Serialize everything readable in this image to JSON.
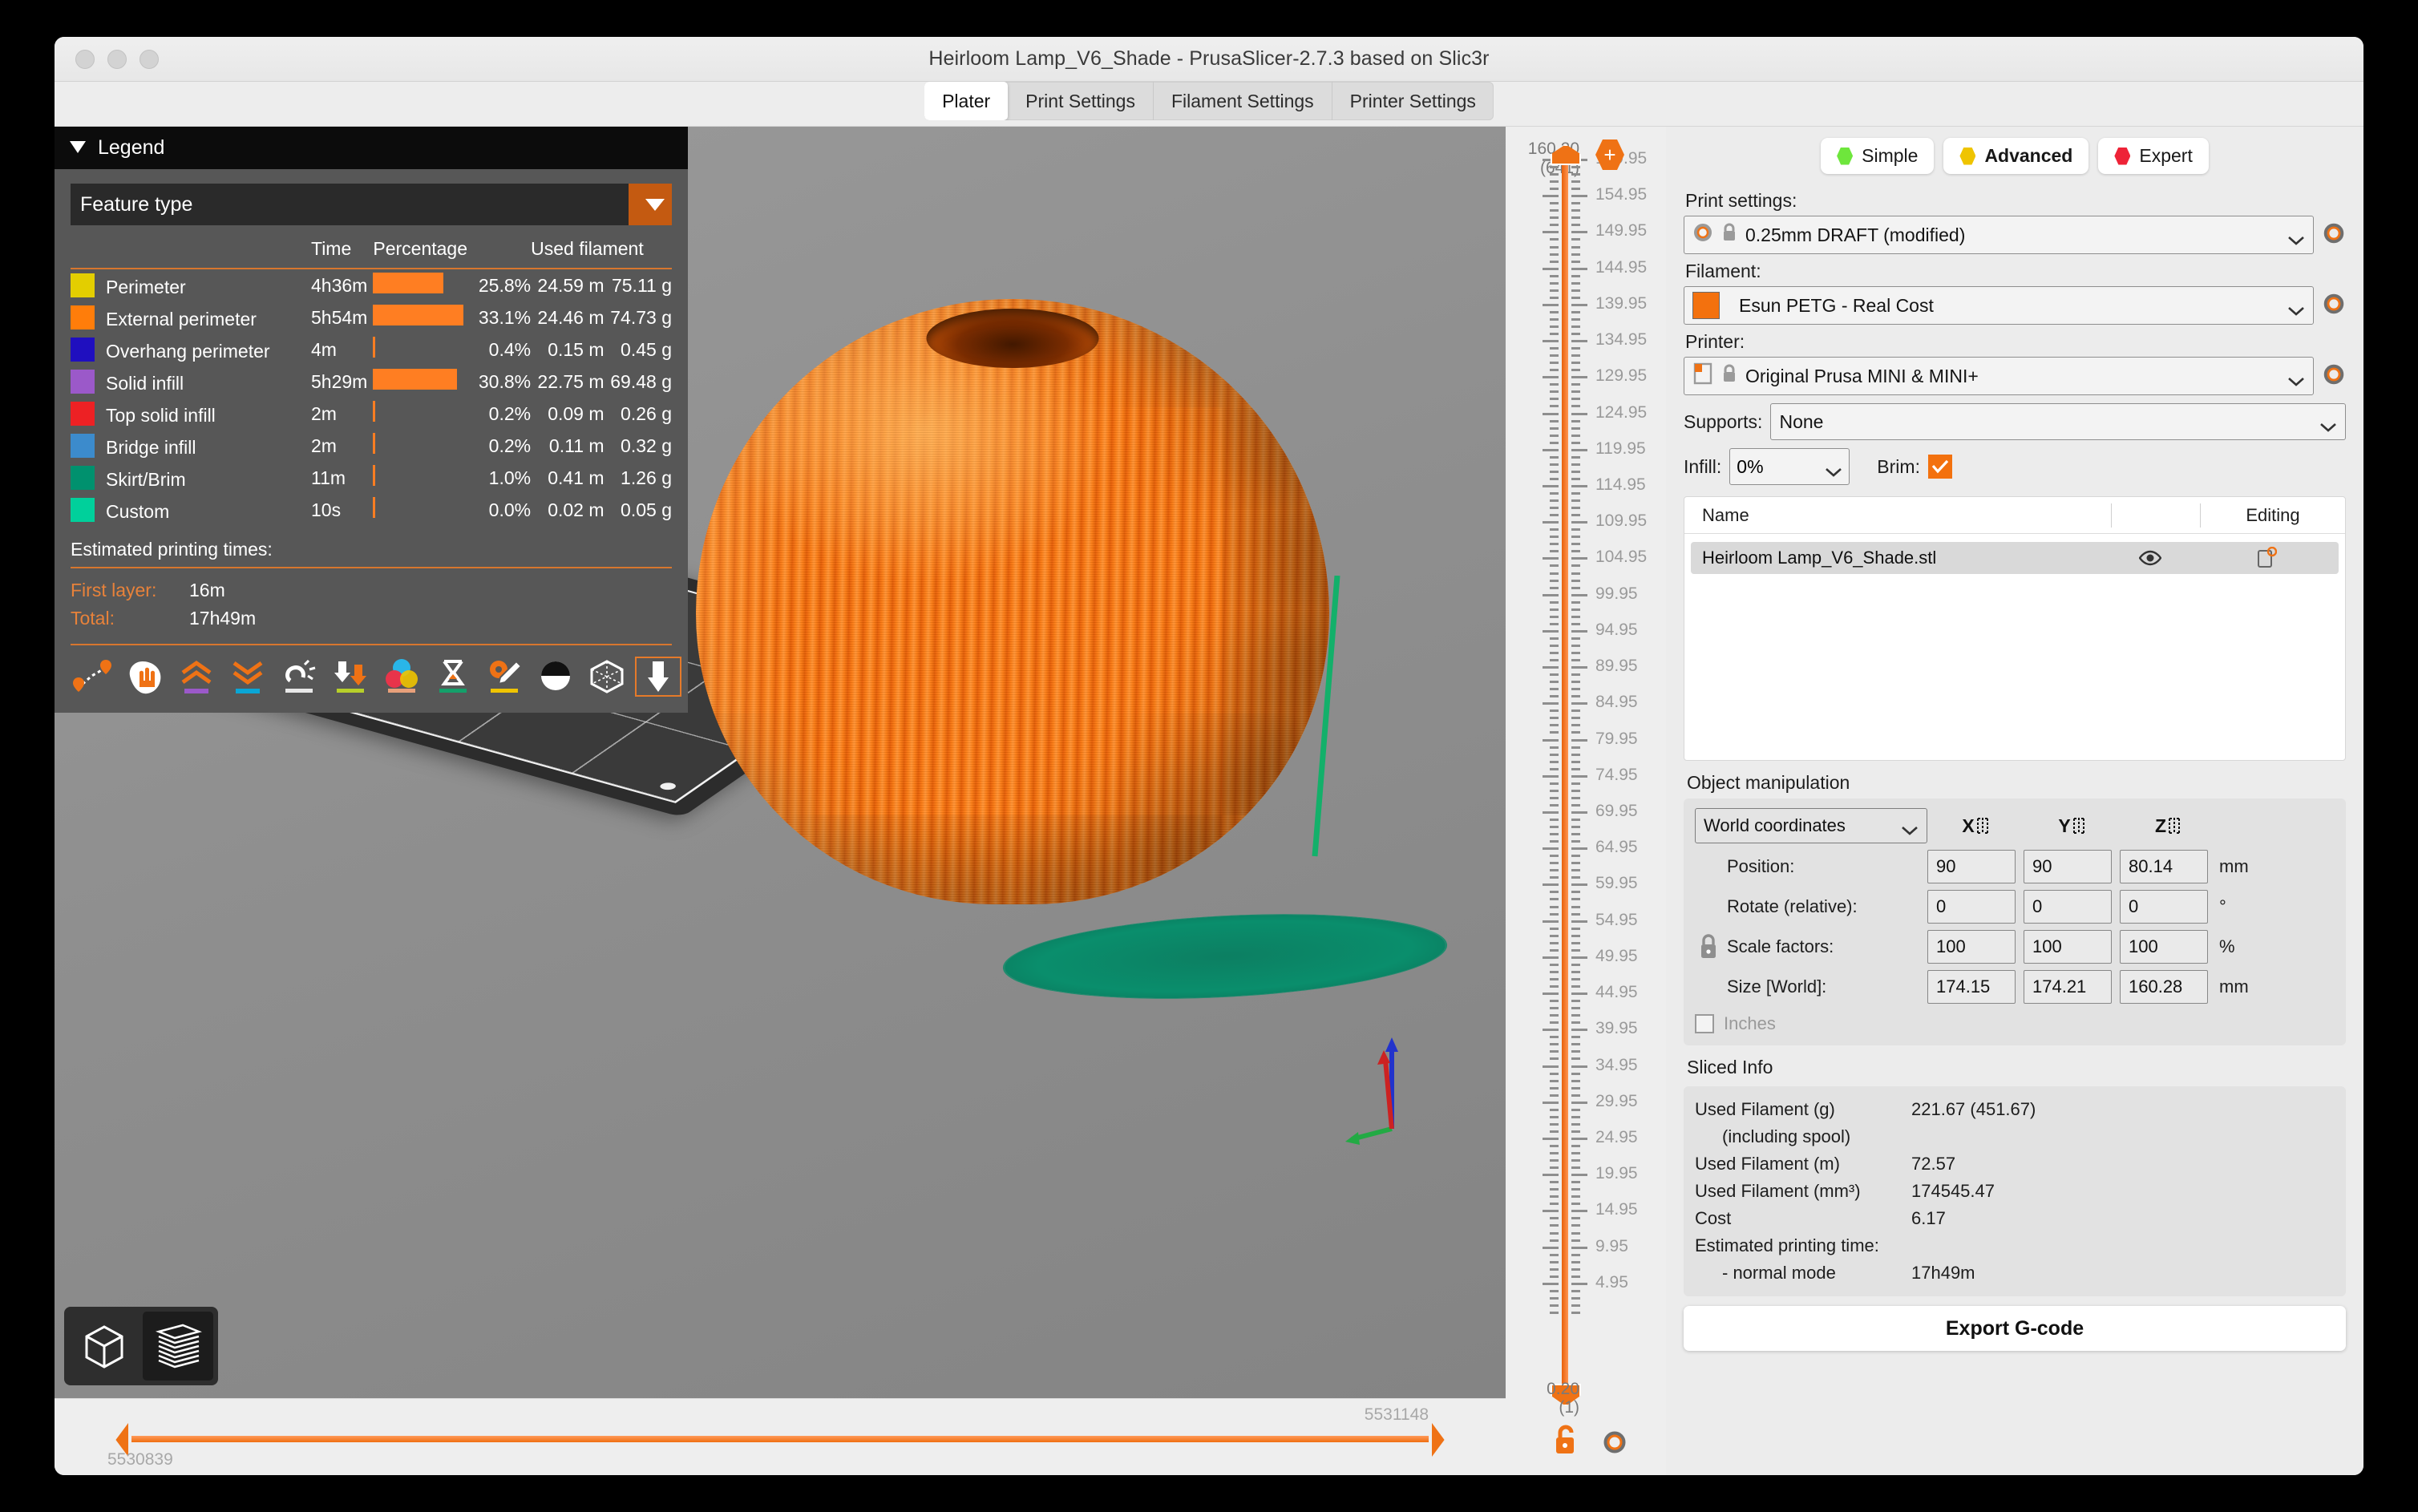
{
  "window": {
    "title": "Heirloom Lamp_V6_Shade - PrusaSlicer-2.7.3 based on Slic3r",
    "traffic_lights": [
      "close",
      "minimize",
      "maximize"
    ]
  },
  "tabs": [
    {
      "label": "Plater",
      "active": true
    },
    {
      "label": "Print Settings",
      "active": false
    },
    {
      "label": "Filament Settings",
      "active": false
    },
    {
      "label": "Printer Settings",
      "active": false
    }
  ],
  "legend": {
    "title": "Legend",
    "view_type": "Feature type",
    "columns": [
      "",
      "Time",
      "Percentage",
      "Used filament"
    ],
    "col_time": "Time",
    "col_percentage": "Percentage",
    "col_filament": "Used filament",
    "rows": [
      {
        "name": "Perimeter",
        "color": "#E3CE00",
        "time": "4h36m",
        "pct": "25.8%",
        "pct_value": 25.8,
        "length": "24.59 m",
        "weight": "75.11 g"
      },
      {
        "name": "External perimeter",
        "color": "#FF7D0A",
        "time": "5h54m",
        "pct": "33.1%",
        "pct_value": 33.1,
        "length": "24.46 m",
        "weight": "74.73 g"
      },
      {
        "name": "Overhang perimeter",
        "color": "#1F0FBF",
        "time": "4m",
        "pct": "0.4%",
        "pct_value": 0.4,
        "length": "0.15 m",
        "weight": "0.45 g"
      },
      {
        "name": "Solid infill",
        "color": "#9B59C9",
        "time": "5h29m",
        "pct": "30.8%",
        "pct_value": 30.8,
        "length": "22.75 m",
        "weight": "69.48 g"
      },
      {
        "name": "Top solid infill",
        "color": "#ED2124",
        "time": "2m",
        "pct": "0.2%",
        "pct_value": 0.2,
        "length": "0.09 m",
        "weight": "0.26 g"
      },
      {
        "name": "Bridge infill",
        "color": "#3C8BCC",
        "time": "2m",
        "pct": "0.2%",
        "pct_value": 0.2,
        "length": "0.11 m",
        "weight": "0.32 g"
      },
      {
        "name": "Skirt/Brim",
        "color": "#00916E",
        "time": "11m",
        "pct": "1.0%",
        "pct_value": 1.0,
        "length": "0.41 m",
        "weight": "1.26 g"
      },
      {
        "name": "Custom",
        "color": "#00D09B",
        "time": "10s",
        "pct": "0.0%",
        "pct_value": 0.0,
        "length": "0.02 m",
        "weight": "0.05 g"
      }
    ],
    "times_header": "Estimated printing times:",
    "first_layer_label": "First layer:",
    "first_layer_value": "16m",
    "total_label": "Total:",
    "total_value": "17h49m",
    "tools": [
      "travel-icon",
      "retractions-icon",
      "seams-up-icon",
      "deretractions-icon",
      "wipe-icon",
      "tool-changes-icon",
      "color-changes-icon",
      "pause-prints-icon",
      "custom-gcodes-icon",
      "shells-icon",
      "tool-marker-icon",
      "legend-nozzle-icon"
    ]
  },
  "viewport": {
    "view_modes": [
      {
        "name": "editor-view",
        "icon": "cube-icon",
        "active": false
      },
      {
        "name": "preview-view",
        "icon": "layers-icon",
        "active": true
      }
    ],
    "axes": {
      "x": "X",
      "y": "Y",
      "z": "Z",
      "x_color": "#cc2222",
      "y_color": "#22aa44",
      "z_color": "#2233cc"
    }
  },
  "layer_slider": {
    "top_value": "160.20",
    "top_layer": "(641)",
    "bottom_value": "0.20",
    "bottom_layer": "(1)",
    "ticks": [
      "159.95",
      "154.95",
      "149.95",
      "144.95",
      "139.95",
      "134.95",
      "129.95",
      "124.95",
      "119.95",
      "114.95",
      "109.95",
      "104.95",
      "99.95",
      "94.95",
      "89.95",
      "84.95",
      "79.95",
      "74.95",
      "69.95",
      "64.95",
      "59.95",
      "54.95",
      "49.95",
      "44.95",
      "39.95",
      "34.95",
      "29.95",
      "24.95",
      "19.95",
      "14.95",
      "9.95",
      "4.95"
    ],
    "add_color_change": "+",
    "lock_icon": "unlocked-icon",
    "gear_icon": "gear-icon"
  },
  "move_slider": {
    "max": "5531148",
    "min": "5530839"
  },
  "right_panel": {
    "modes": [
      {
        "label": "Simple",
        "color": "#6EE63C",
        "active": false
      },
      {
        "label": "Advanced",
        "color": "#EFC400",
        "active": true
      },
      {
        "label": "Expert",
        "color": "#EE2337",
        "active": false
      }
    ],
    "print_settings_label": "Print settings:",
    "print_settings_value": "0.25mm DRAFT (modified)",
    "filament_label": "Filament:",
    "filament_value": "Esun PETG - Real Cost",
    "filament_color": "#F3710E",
    "printer_label": "Printer:",
    "printer_value": "Original Prusa MINI & MINI+",
    "supports_label": "Supports:",
    "supports_value": "None",
    "infill_label": "Infill:",
    "infill_value": "0%",
    "brim_label": "Brim:",
    "brim_checked": true
  },
  "object_list": {
    "columns": {
      "name": "Name",
      "editing": "Editing"
    },
    "rows": [
      {
        "name": "Heirloom Lamp_V6_Shade.stl",
        "eye": "eye-icon",
        "editing": "edit-icon",
        "selected": true
      }
    ]
  },
  "object_manipulation": {
    "title": "Object manipulation",
    "coord_system": "World coordinates",
    "axis_labels": {
      "x": "X",
      "y": "Y",
      "z": "Z"
    },
    "rows": [
      {
        "label": "Position:",
        "x": "90",
        "y": "90",
        "z": "80.14",
        "unit": "mm"
      },
      {
        "label": "Rotate (relative):",
        "x": "0",
        "y": "0",
        "z": "0",
        "unit": "°"
      },
      {
        "label": "Scale factors:",
        "x": "100",
        "y": "100",
        "z": "100",
        "unit": "%"
      },
      {
        "label": "Size [World]:",
        "x": "174.15",
        "y": "174.21",
        "z": "160.28",
        "unit": "mm"
      }
    ],
    "inches_label": "Inches",
    "inches_checked": false
  },
  "sliced_info": {
    "title": "Sliced Info",
    "rows": [
      {
        "label": "Used Filament (g)",
        "sub": "(including spool)",
        "value": "221.67 (451.67)"
      },
      {
        "label": "Used Filament (m)",
        "sub": "",
        "value": "72.57"
      },
      {
        "label": "Used Filament (mm³)",
        "sub": "",
        "value": "174545.47"
      },
      {
        "label": "Cost",
        "sub": "",
        "value": "6.17"
      },
      {
        "label": "Estimated printing time:",
        "sub": "- normal mode",
        "value": "17h49m"
      }
    ]
  },
  "export_button": "Export G-code"
}
